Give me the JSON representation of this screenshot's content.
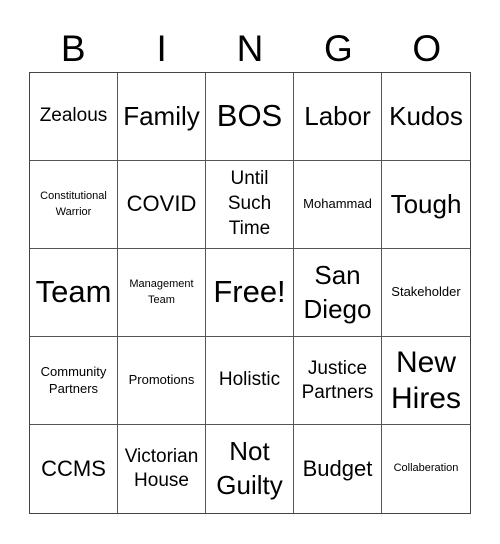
{
  "header": {
    "letters": [
      "B",
      "I",
      "N",
      "G",
      "O"
    ]
  },
  "card": {
    "rows": [
      [
        "Zealous",
        "Family",
        "BOS",
        "Labor",
        "Kudos"
      ],
      [
        "Constitutional Warrior",
        "COVID",
        "Until Such Time",
        "Mohammad",
        "Tough"
      ],
      [
        "Team",
        "Management Team",
        "Free!",
        "San Diego",
        "Stakeholder"
      ],
      [
        "Community Partners",
        "Promotions",
        "Holistic",
        "Justice Partners",
        "New Hires"
      ],
      [
        "CCMS",
        "Victorian House",
        "Not Guilty",
        "Budget",
        "Collaberation"
      ]
    ]
  }
}
